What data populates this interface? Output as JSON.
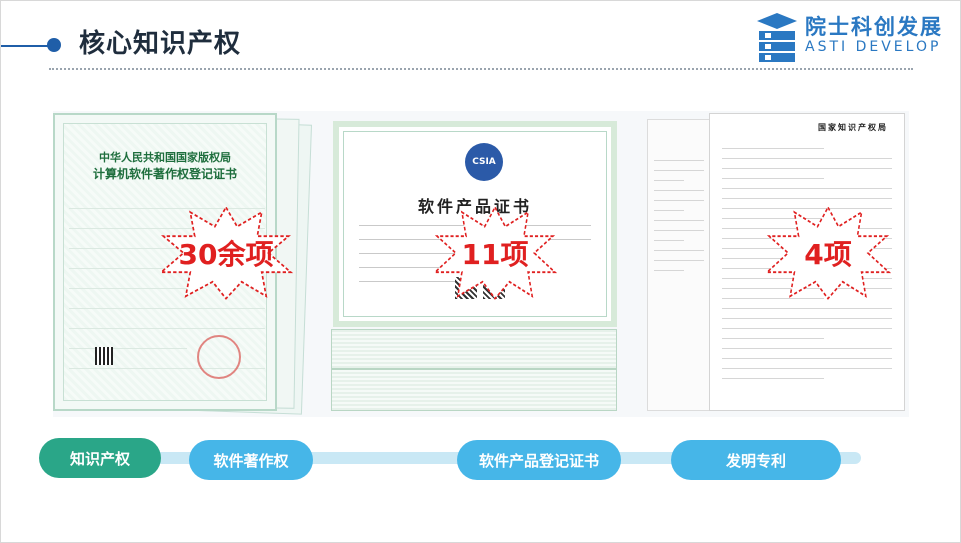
{
  "header": {
    "title": "核心知识产权",
    "logo_cn": "院士科创发展",
    "logo_en": "ASTI DEVELOP"
  },
  "certificates": {
    "software_copyright": {
      "heading_line1": "中华人民共和国国家版权局",
      "heading_line2": "计算机软件著作权登记证书"
    },
    "product_certificate": {
      "badge": "CSIA",
      "title": "软件产品证书"
    },
    "patent": {
      "title": "国家知识产权局"
    }
  },
  "highlights": {
    "copyright_count": "30余项",
    "product_count": "11项",
    "patent_count": "4项"
  },
  "bottom_nav": {
    "items": [
      {
        "label": "知识产权",
        "style": "primary"
      },
      {
        "label": "软件著作权",
        "style": "secondary"
      },
      {
        "label": "软件产品登记证书",
        "style": "secondary"
      },
      {
        "label": "发明专利",
        "style": "secondary"
      }
    ]
  },
  "colors": {
    "title_text": "#1f2d3d",
    "accent_blue": "#2a78c2",
    "star_red": "#e02020",
    "pill_green": "#2aa688",
    "pill_blue": "#46b6e8",
    "track": "#c9e8f5"
  }
}
